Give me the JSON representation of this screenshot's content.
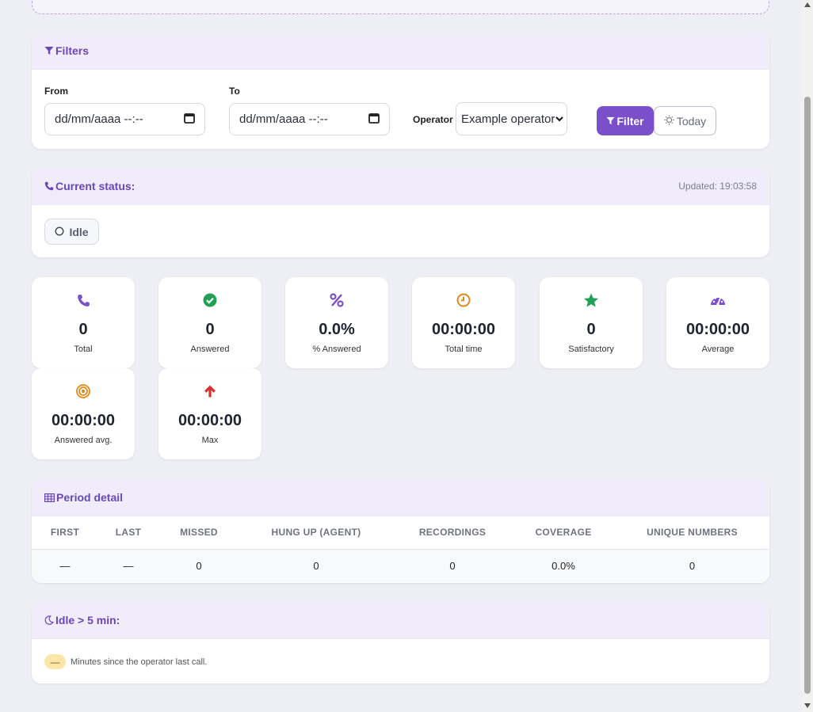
{
  "filters": {
    "title": "Filters",
    "from_label": "From",
    "to_label": "To",
    "from_value": "dd/mm/aaaa --:--",
    "to_value": "dd/mm/aaaa --:--",
    "operator_label": "Operator",
    "operator_value": "Example operator",
    "filter_button": "Filter",
    "today_button": "Today",
    "accent": "#7a4fc9"
  },
  "status": {
    "title": "Current status:",
    "updated": "Updated: 19:03:58",
    "state": "Idle"
  },
  "kpis": [
    {
      "icon": "phone-icon",
      "value": "0",
      "label": "Total",
      "color": "#7a4fc9"
    },
    {
      "icon": "check-circle-icon",
      "value": "0",
      "label": "Answered",
      "color": "#22a055"
    },
    {
      "icon": "percent-icon",
      "value": "0.0%",
      "label": "% Answered",
      "color": "#7a4fc9"
    },
    {
      "icon": "clock-icon",
      "value": "00:00:00",
      "label": "Total time",
      "color": "#e08a1e"
    },
    {
      "icon": "star-icon",
      "value": "0",
      "label": "Satisfactory",
      "color": "#22a055"
    },
    {
      "icon": "gauge-icon",
      "value": "00:00:00",
      "label": "Average",
      "color": "#7a4fc9"
    },
    {
      "icon": "target-icon",
      "value": "00:00:00",
      "label": "Answered avg.",
      "color": "#e08a1e"
    },
    {
      "icon": "arrow-up-icon",
      "value": "00:00:00",
      "label": "Max",
      "color": "#d9302c"
    }
  ],
  "period": {
    "title": "Period detail",
    "headers": [
      "FIRST",
      "LAST",
      "MISSED",
      "HUNG UP (AGENT)",
      "RECORDINGS",
      "COVERAGE",
      "UNIQUE NUMBERS"
    ],
    "row": [
      "—",
      "—",
      "0",
      "0",
      "0",
      "0.0%",
      "0"
    ]
  },
  "idle": {
    "title": "Idle > 5 min:",
    "badge": "—",
    "note": "Minutes since the operator last call."
  }
}
